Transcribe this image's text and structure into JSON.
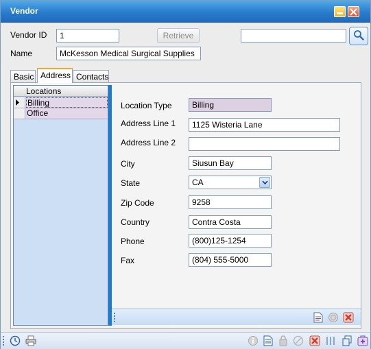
{
  "window": {
    "title": "Vendor"
  },
  "header": {
    "vendor_id_label": "Vendor ID",
    "vendor_id_value": "1",
    "name_label": "Name",
    "name_value": "McKesson Medical Surgical Supplies",
    "retrieve_label": "Retrieve",
    "search_value": ""
  },
  "tabs": [
    {
      "label": "Basic"
    },
    {
      "label": "Address"
    },
    {
      "label": "Contacts"
    }
  ],
  "locations": {
    "header": "Locations",
    "rows": [
      "Billing",
      "Office"
    ]
  },
  "address": {
    "location_type_label": "Location Type",
    "location_type_value": "Billing",
    "line1_label": "Address Line 1",
    "line1_value": "1125 Wisteria Lane",
    "line2_label": "Address Line 2",
    "line2_value": "",
    "city_label": "City",
    "city_value": "Siusun Bay",
    "state_label": "State",
    "state_value": "CA",
    "zip_label": "Zip Code",
    "zip_value": "9258",
    "country_label": "Country",
    "country_value": "Contra Costa",
    "phone_label": "Phone",
    "phone_value": "(800)125-1254",
    "fax_label": "Fax",
    "fax_value": "(804) 555-5000"
  },
  "icons": {
    "minimize": "minimize-icon",
    "close": "close-icon",
    "search": "magnifier-icon",
    "new_doc": "new-document-icon",
    "cancel": "cancel-icon",
    "delete": "delete-icon",
    "clock": "clock-icon",
    "print": "printer-icon",
    "info": "info-icon",
    "lock": "lock-icon"
  },
  "colors": {
    "title_bar": "#2a7ccd",
    "readonly_field": "#dcd0e2",
    "grid_background": "#cddff4",
    "splitter": "#1e7bd0",
    "delete_red": "#d8392b"
  }
}
